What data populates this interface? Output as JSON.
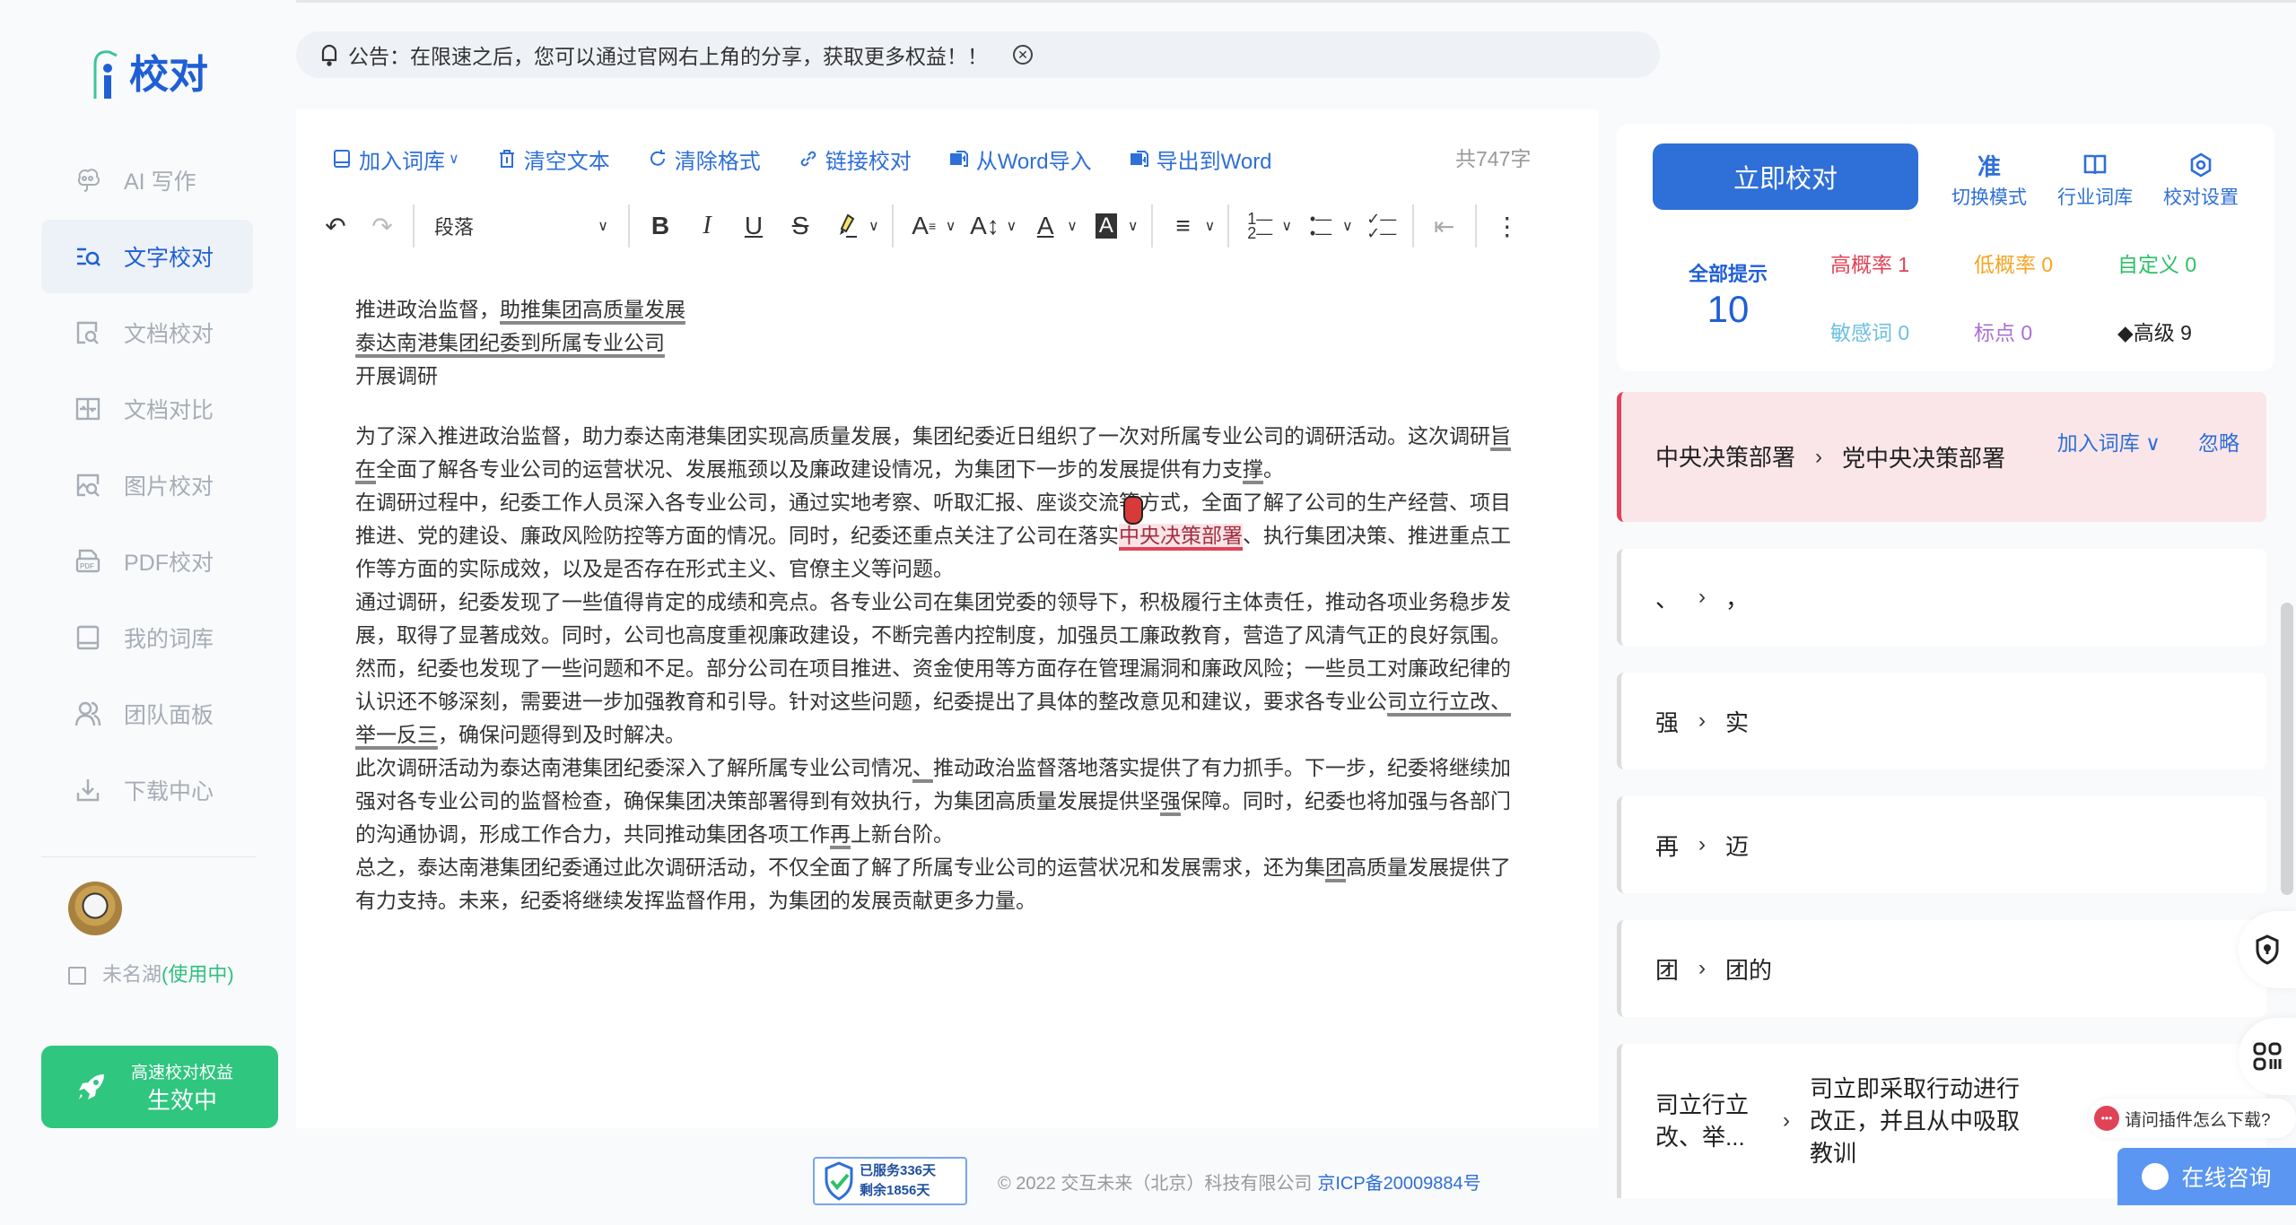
{
  "brand": {
    "logo_text": "校对"
  },
  "sidebar": {
    "items": [
      {
        "label": "AI 写作",
        "icon": "brain-icon",
        "active": false
      },
      {
        "label": "文字校对",
        "icon": "text-search-icon",
        "active": true
      },
      {
        "label": "文档校对",
        "icon": "doc-search-icon",
        "active": false
      },
      {
        "label": "文档对比",
        "icon": "doc-compare-icon",
        "active": false
      },
      {
        "label": "图片校对",
        "icon": "image-search-icon",
        "active": false
      },
      {
        "label": "PDF校对",
        "icon": "pdf-icon",
        "active": false
      },
      {
        "label": "我的词库",
        "icon": "book-icon",
        "active": false
      },
      {
        "label": "团队面板",
        "icon": "team-icon",
        "active": false
      },
      {
        "label": "下载中心",
        "icon": "download-icon",
        "active": false
      }
    ],
    "user": {
      "name": "未名湖",
      "status": "(使用中)"
    },
    "speed": {
      "line1": "高速校对权益",
      "line2": "生效中"
    }
  },
  "notice": {
    "text": "公告：在限速之后，您可以通过官网右上角的分享，获取更多权益！！"
  },
  "editor": {
    "actions": [
      {
        "label": "加入词库",
        "icon": "book-icon",
        "dropdown": true
      },
      {
        "label": "清空文本",
        "icon": "trash-icon"
      },
      {
        "label": "清除格式",
        "icon": "refresh-icon"
      },
      {
        "label": "链接校对",
        "icon": "link-icon"
      },
      {
        "label": "从Word导入",
        "icon": "word-import-icon"
      },
      {
        "label": "导出到Word",
        "icon": "word-export-icon"
      }
    ],
    "word_count": "共747字",
    "paragraph_style": "段落",
    "title_lines": {
      "l1a": "推进政治监督，",
      "l1b": "助推集团高质量发展",
      "l2": "泰达南港集团纪委到所属专业公司",
      "l3": "开展调研"
    },
    "body": {
      "p1a": "为了深入推进政治监督，助力泰达南港集团实现高质量发展，集团纪委近日组织了一次对所属专业公司的调研活动。这次调研",
      "p1b": "旨",
      "p1c": "在",
      "p1d": "全面了解各专业公司的运营状况、发展瓶颈以及廉政建设情况，为集团下一步的发展提供有力支",
      "p1e": "撑",
      "p1f": "。",
      "p2a": "在调研过程中，纪委工作人员深入各专业公司，通过实地考察、听取汇报、座谈交流等方式，全面了解了公司的生产经营、项目推进、党的建设、廉政风险防控等方面的情况。同时，纪委还重点关注了公司在落实",
      "p2b": "中央决策部署",
      "p2c": "、执行集团决策、推进重点工作等方面的实际成效，以及是否存在形式主义、官僚主义等问题。",
      "p3": "通过调研，纪委发现了一些值得肯定的成绩和亮点。各专业公司在集团党委的领导下，积极履行主体责任，推动各项业务稳步发展，取得了显著成效。同时，公司也高度重视廉政建设，不断完善内控制度，加强员工廉政教育，营造了风清气正的良好氛围。",
      "p4a": "然而，纪委也发现了一些问题和不足。部分公司在项目推进、资金使用等方面存在管理漏洞和廉政风险；一些员工对廉政纪律的认识还不够深刻，需要进一步加强教育和引导。针对这些问题，纪委提出了具体的整改意见和建议，要求各专业公",
      "p4b": "司立行立改、举一反三",
      "p4c": "，确保问题得到及时解决。",
      "p5a": "此次调研活动为泰达南港集团纪委深入了解所属专业公司情况",
      "p5b": "、",
      "p5c": "推动政治监督落地落实提供了有力抓手。下一步，纪委将继续加强对各专业公司的监督检查，确保集团决策部署得到有效执行，为集团高质量发展提供坚",
      "p5d": "强",
      "p5e": "保障。同时，纪委也将加强与各部门的沟通协调，形成工作合力，共同推动集团各项工作",
      "p5f": "再",
      "p5g": "上新台阶。",
      "p6a": "总之，泰达南港集团纪委通过此次调研活动，不仅全面了解了所属专业公司的运营状况和发展需求，还为集",
      "p6b": "团",
      "p6c": "高质量发展提供了有力支持。未来，纪委将继续发挥监督作用，为集团的发展贡献更多力量。"
    }
  },
  "panel": {
    "check_button": "立即校对",
    "tools": [
      {
        "glyph": "准",
        "label": "切换模式"
      },
      {
        "glyph": "book",
        "label": "行业词库"
      },
      {
        "glyph": "gear",
        "label": "校对设置"
      }
    ],
    "all_label": "全部提示",
    "all_count": "10",
    "stats": [
      {
        "label": "高概率 1",
        "color": "#e04357"
      },
      {
        "label": "低概率 0",
        "color": "#f5a623"
      },
      {
        "label": "自定义 0",
        "color": "#2fc067"
      },
      {
        "label": "敏感词 0",
        "color": "#6cc0e0"
      },
      {
        "label": "标点 0",
        "color": "#a86fd8"
      },
      {
        "label": "高级 9",
        "color": "#222222"
      }
    ],
    "issues": [
      {
        "from": "中央决策部署",
        "to": "党中央决策部署",
        "add_label": "加入词库",
        "ignore_label": "忽略",
        "active": true
      },
      {
        "from": "、",
        "to": "，"
      },
      {
        "from": "强",
        "to": "实"
      },
      {
        "from": "再",
        "to": "迈"
      },
      {
        "from": "团",
        "to": "团的"
      },
      {
        "from": "司立行立改、举...",
        "to": "司立即采取行动进行改正，并且从中吸取教训"
      }
    ]
  },
  "floating": {
    "faq": "请问插件怎么下载?",
    "consult": "在线咨询"
  },
  "footer": {
    "badge_line1": "已服务336天",
    "badge_line2": "剩余1856天",
    "copyright": "© 2022 交互未来（北京）科技有限公司",
    "icp": "京ICP备20009884号"
  }
}
